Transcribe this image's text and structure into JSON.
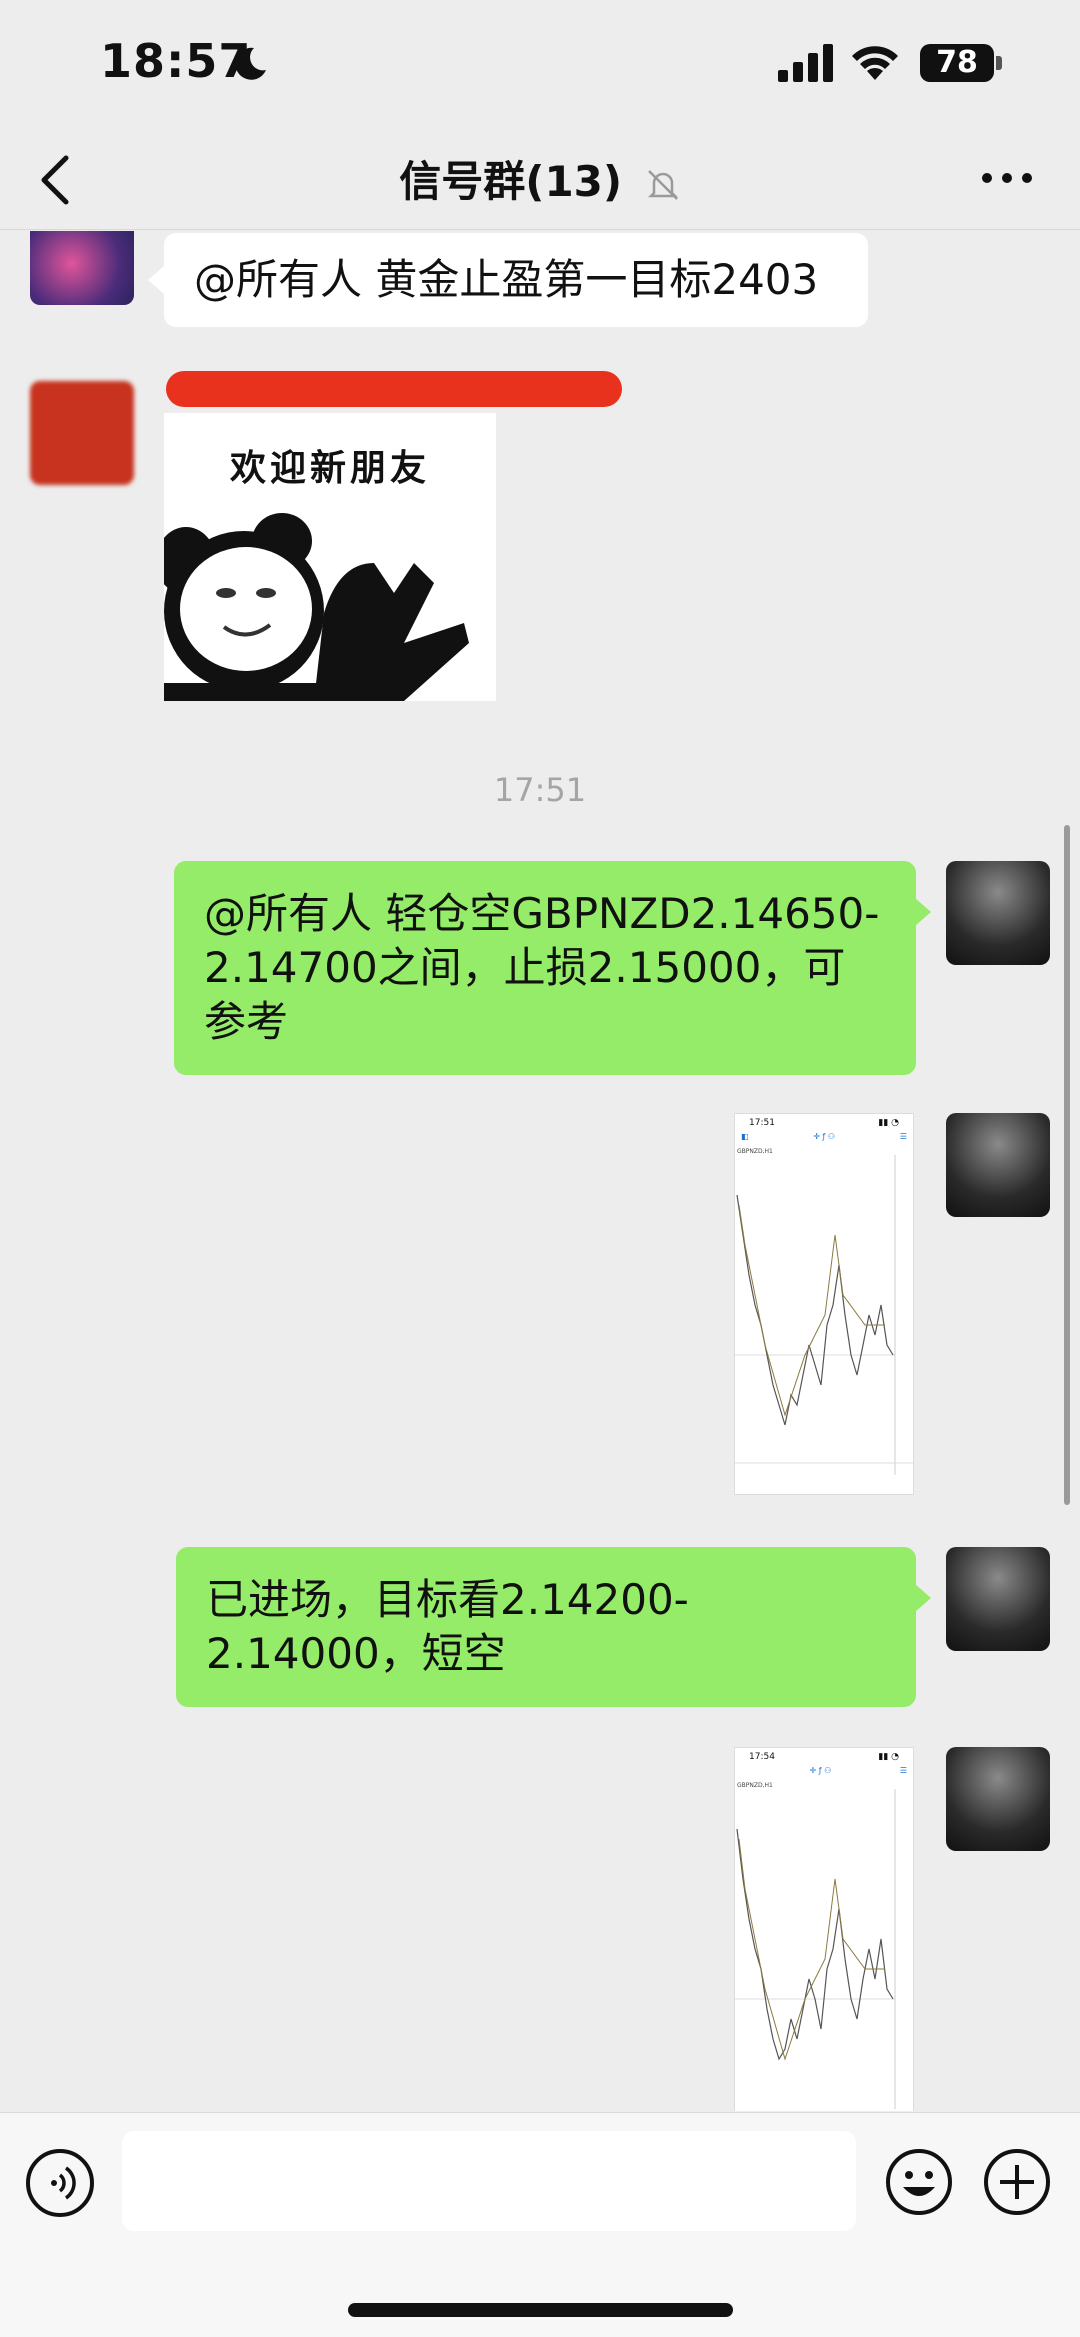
{
  "status_bar": {
    "time": "18:57",
    "battery": "78"
  },
  "nav": {
    "title": "信号群(13)"
  },
  "messages": [
    {
      "side": "left",
      "text": "@所有人 黄金止盈第一目标2403"
    },
    {
      "side": "left",
      "sticker_text": "欢迎新朋友"
    },
    {
      "type": "time",
      "text": "17:51"
    },
    {
      "side": "right",
      "text": "@所有人  轻仓空GBPNZD2.14650-2.14700之间，止损2.15000，可参考"
    },
    {
      "side": "right",
      "image": {
        "status_time": "17:51",
        "symbol": "GBPNZD,H1"
      }
    },
    {
      "side": "right",
      "text": "已进场，目标看2.14200-2.14000，短空"
    },
    {
      "side": "right",
      "image": {
        "status_time": "17:54",
        "symbol": "GBPNZD,H1"
      }
    }
  ],
  "input": {
    "placeholder": ""
  },
  "colors": {
    "background": "#ededed",
    "self_bubble": "#95ec69",
    "other_bubble": "#ffffff",
    "redaction": "#e8321e"
  },
  "icons": [
    "moon-icon",
    "signal-icon",
    "wifi-icon",
    "back-icon",
    "mute-icon",
    "more-icon",
    "voice-icon",
    "emoji-icon",
    "plus-icon"
  ]
}
